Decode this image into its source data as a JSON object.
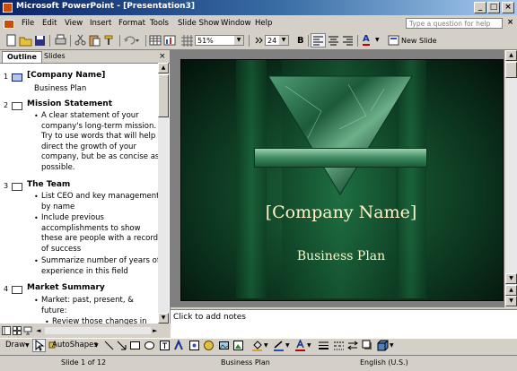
{
  "window": {
    "title": "Microsoft PowerPoint - [Presentation3]",
    "minimize_glyph": "_",
    "maximize_glyph": "□",
    "close_glyph": "×"
  },
  "menubar": {
    "items": [
      "File",
      "Edit",
      "View",
      "Insert",
      "Format",
      "Tools",
      "Slide Show",
      "Window",
      "Help"
    ],
    "help_placeholder": "Type a question for help",
    "doc_close_glyph": "×"
  },
  "toolbar": {
    "zoom": "51%",
    "font_size": "24",
    "bold_glyph": "B",
    "font_color_glyph": "A",
    "new_slide_label": "New Slide"
  },
  "outline_pane": {
    "tabs": [
      "Outline",
      "Slides"
    ],
    "close_glyph": "×",
    "slides": [
      {
        "num": "1",
        "title": "[Company Name]",
        "subtitle": "Business Plan"
      },
      {
        "num": "2",
        "title": "Mission Statement",
        "bullets": [
          [
            "A clear statement of your",
            "company's long-term mission.",
            "Try to use words that will help",
            "direct the growth of your",
            "company, but be as concise as",
            "possible."
          ]
        ]
      },
      {
        "num": "3",
        "title": "The Team",
        "bullets": [
          [
            "List CEO and key management",
            "by name"
          ],
          [
            "Include previous",
            "accomplishments to show",
            "these are people with a record",
            "of success"
          ],
          [
            "Summarize number of years of",
            "experience in this field"
          ]
        ]
      },
      {
        "num": "4",
        "title": "Market Summary",
        "bullets": [
          [
            "Market: past, present, &",
            "future:"
          ]
        ],
        "sub_bullets": [
          [
            "Review those changes in"
          ]
        ]
      }
    ]
  },
  "slide": {
    "title": "[Company Name]",
    "subtitle": "Business Plan",
    "colors": {
      "background": "#0e3b22",
      "text": "#fff5c9",
      "accent": "#2a8a55"
    }
  },
  "notes": {
    "placeholder": "Click to add notes"
  },
  "drawbar": {
    "draw_label": "Draw",
    "autoshapes_label": "AutoShapes"
  },
  "status": {
    "slide": "Slide 1 of 12",
    "design": "Business Plan",
    "language": "English (U.S.)"
  }
}
